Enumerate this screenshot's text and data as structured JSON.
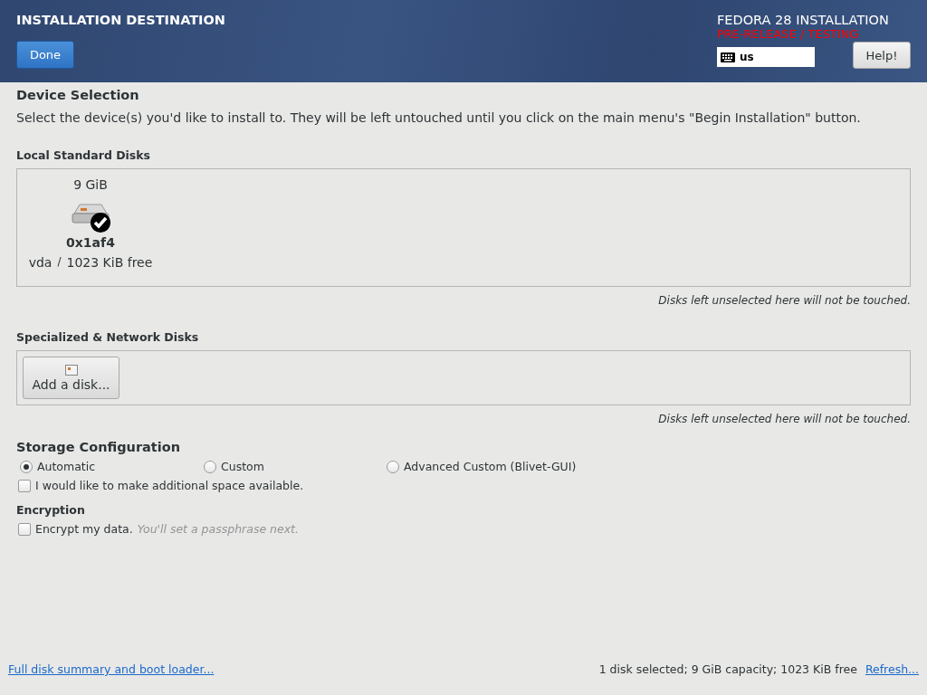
{
  "header": {
    "title": "INSTALLATION DESTINATION",
    "done_button": "Done",
    "product": "FEDORA 28 INSTALLATION",
    "prerelease": "PRE-RELEASE / TESTING",
    "keyboard_layout": "us",
    "help_button": "Help!"
  },
  "device_selection": {
    "heading": "Device Selection",
    "description": "Select the device(s) you'd like to install to.  They will be left untouched until you click on the main menu's \"Begin Installation\" button."
  },
  "local_disks": {
    "heading": "Local Standard Disks",
    "disks": [
      {
        "size": "9 GiB",
        "name": "0x1af4",
        "device": "vda",
        "separator": "/",
        "free": "1023 KiB free",
        "selected": true
      }
    ],
    "note": "Disks left unselected here will not be touched."
  },
  "network_disks": {
    "heading": "Specialized & Network Disks",
    "add_button": "Add a disk...",
    "note": "Disks left unselected here will not be touched."
  },
  "storage_configuration": {
    "heading": "Storage Configuration",
    "options": [
      {
        "label": "Automatic",
        "selected": true
      },
      {
        "label": "Custom",
        "selected": false
      },
      {
        "label": "Advanced Custom (Blivet-GUI)",
        "selected": false
      }
    ],
    "extra_space": {
      "label": "I would like to make additional space available.",
      "checked": false
    }
  },
  "encryption": {
    "heading": "Encryption",
    "encrypt": {
      "label": "Encrypt my data.",
      "hint": "You'll set a passphrase next.",
      "checked": false
    }
  },
  "footer": {
    "summary_link": "Full disk summary and boot loader...",
    "status": "1 disk selected; 9 GiB capacity; 1023 KiB free",
    "refresh_link": "Refresh..."
  }
}
